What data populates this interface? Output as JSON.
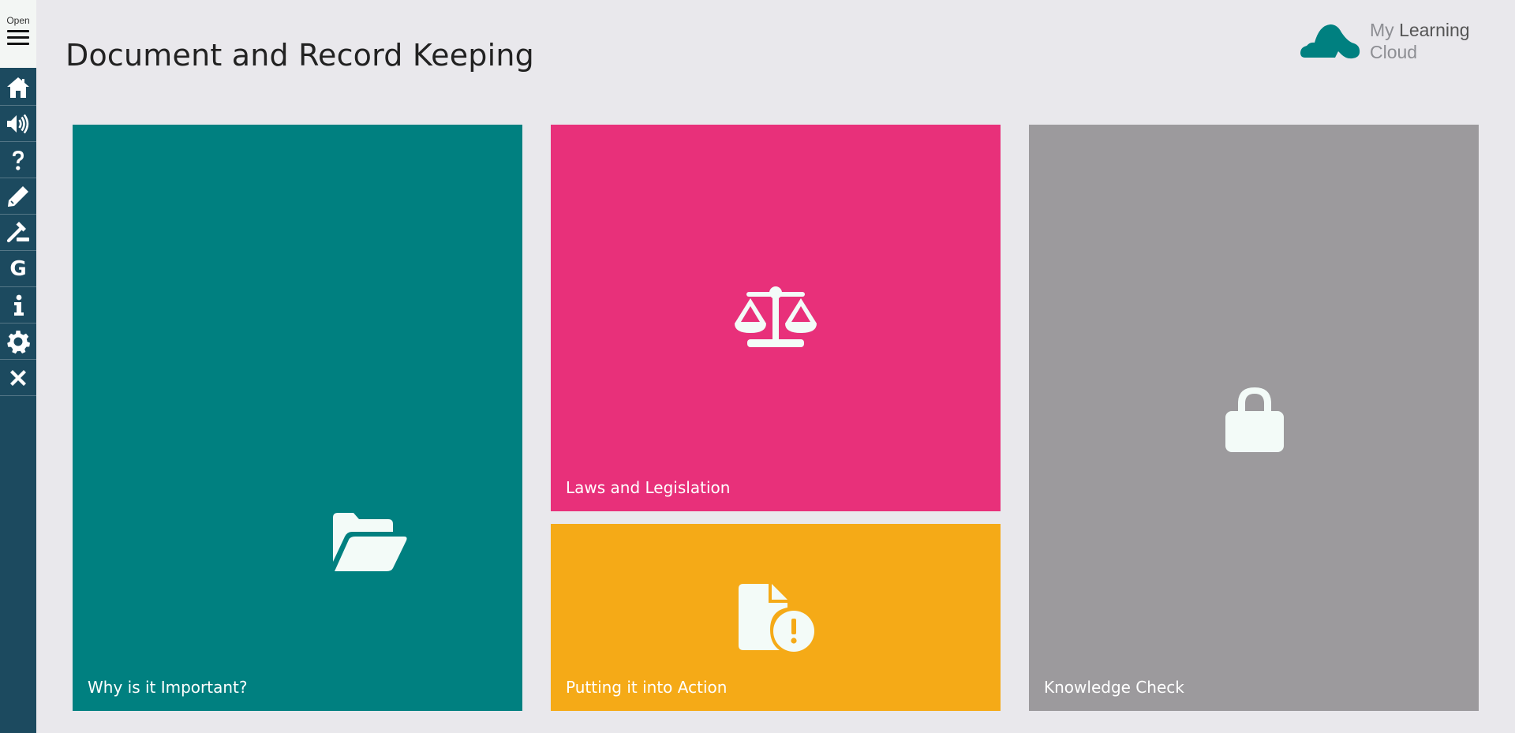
{
  "sidebar": {
    "open_label": "Open",
    "items": [
      {
        "name": "home-icon"
      },
      {
        "name": "audio-icon"
      },
      {
        "name": "help-icon"
      },
      {
        "name": "pencil-icon"
      },
      {
        "name": "gavel-icon"
      },
      {
        "name": "glossary-icon",
        "glyph": "G"
      },
      {
        "name": "info-icon"
      },
      {
        "name": "gear-icon"
      },
      {
        "name": "close-icon"
      }
    ]
  },
  "header": {
    "title": "Document and Record Keeping"
  },
  "logo": {
    "line1_light": "My ",
    "line1_strong": "Learning",
    "line2": "Cloud",
    "icon": "cloud-icon"
  },
  "tiles": [
    {
      "label": "Why is it Important?",
      "icon": "folder-open-icon",
      "color": "#008080"
    },
    {
      "label": "Laws and Legislation",
      "icon": "scales-icon",
      "color": "#e8307a"
    },
    {
      "label": "Putting it into Action",
      "icon": "document-alert-icon",
      "color": "#f5aa17"
    },
    {
      "label": "Knowledge Check",
      "icon": "lock-icon",
      "color": "#9c9a9d",
      "locked": true
    }
  ],
  "colors": {
    "sidebar": "#1c4a5f",
    "background": "#e9e8ec",
    "brand_teal": "#008080"
  }
}
